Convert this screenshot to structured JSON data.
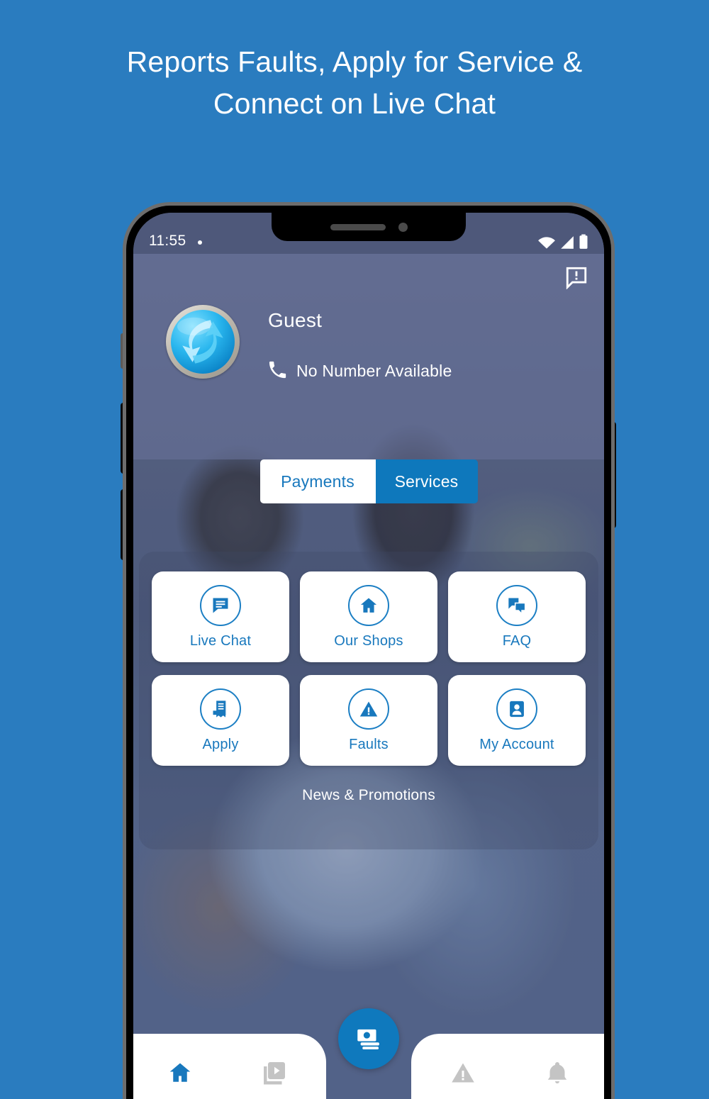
{
  "headline": {
    "line1": "Reports Faults, Apply for Service &",
    "line2": "Connect on Live Chat"
  },
  "colors": {
    "background": "#2a7cbf",
    "accent": "#0e78bc",
    "tile_label": "#1878bd",
    "statusbar": "#4e587a",
    "inactive_nav": "#c4c4c4"
  },
  "statusbar": {
    "time": "11:55",
    "icons": [
      "wifi-icon",
      "signal-icon",
      "battery-icon"
    ]
  },
  "app": {
    "feedback_icon": "feedback-icon",
    "profile": {
      "name": "Guest",
      "phone_number": "No Number Available",
      "phone_icon": "phone-icon",
      "avatar_icon": "app-logo-avatar"
    },
    "toggles": [
      {
        "label": "Payments",
        "active": false
      },
      {
        "label": "Services",
        "active": true
      }
    ],
    "services": [
      {
        "label": "Live Chat",
        "icon": "chat-bubble-icon"
      },
      {
        "label": "Our Shops",
        "icon": "home-icon"
      },
      {
        "label": "FAQ",
        "icon": "double-chat-icon"
      },
      {
        "label": "Apply",
        "icon": "document-icon"
      },
      {
        "label": "Faults",
        "icon": "warning-triangle-icon"
      },
      {
        "label": "My Account",
        "icon": "contact-card-icon"
      }
    ],
    "news_label": "News & Promotions",
    "bottom_nav": [
      {
        "name": "home",
        "icon": "home-icon",
        "active": true
      },
      {
        "name": "media",
        "icon": "video-library-icon",
        "active": false
      },
      {
        "name": "payments",
        "icon": "banknotes-icon",
        "active": true
      },
      {
        "name": "faults",
        "icon": "warning-triangle-icon",
        "active": false
      },
      {
        "name": "alerts",
        "icon": "bell-icon",
        "active": false
      }
    ]
  }
}
